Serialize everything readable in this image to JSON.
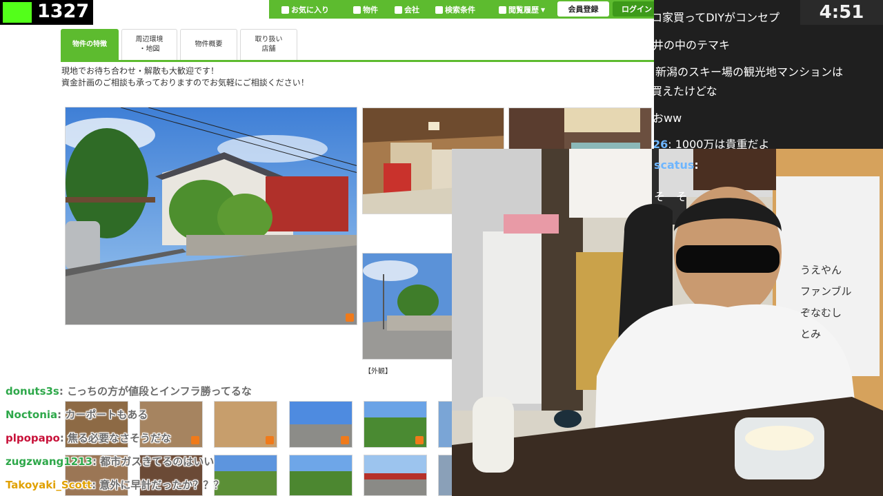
{
  "counter": {
    "value": "1327"
  },
  "timer": {
    "value": "4:51"
  },
  "nav": {
    "favorites": "お気に入り",
    "property": "物件",
    "company": "会社",
    "search": "検索条件",
    "history": "閲覧履歴",
    "register": "会員登録",
    "login": "ログイン"
  },
  "tabs": [
    {
      "label": "物件の特徴",
      "active": true
    },
    {
      "label": "周辺環境\n・地図"
    },
    {
      "label": "物件概要"
    },
    {
      "label": "取り扱い\n店舗"
    }
  ],
  "description": {
    "line1": "現地でお待ち合わせ・解散も大歓迎です！",
    "line2": "資金計画のご相談も承っておりますのでお気軽にご相談ください！"
  },
  "photo_caption": "【外観】",
  "right_chat": [
    {
      "text": "ロ家買ってDIYがコンセプ"
    },
    {
      "text": "井の中のテマキ"
    },
    {
      "text": "新潟のスキー場の観光地マンションは"
    },
    {
      "text": "買えたけどな"
    },
    {
      "text": "おww"
    },
    {
      "user": "26",
      "text": ": 1000万は貴重だよ"
    },
    {
      "user": "scatus",
      "text": ":"
    },
    {
      "text": "そ　そ"
    }
  ],
  "overlay_chat": [
    {
      "user": "donuts3s",
      "color": "#2ea84a",
      "text": ": こっちの方が値段とインフラ勝ってるな"
    },
    {
      "user": "Noctonia",
      "color": "#2ea84a",
      "text": ": カーポートもある"
    },
    {
      "user": "plpopapo",
      "color": "#c8123a",
      "text": ": 焦る必要なさそうだな"
    },
    {
      "user": "zugzwang1213",
      "color": "#2ea84a",
      "text": ": 都市ガスきてるのはいい"
    },
    {
      "user": "Takoyaki_Scott",
      "color": "#e1a100",
      "text": ": 意外に早計だったか？？？"
    }
  ],
  "board_names": [
    "うえやん",
    "ファンブル",
    "ぞなむし",
    "とみ"
  ],
  "colors": {
    "brand_green": "#5dbb2f",
    "counter_green": "#53ff1a"
  }
}
